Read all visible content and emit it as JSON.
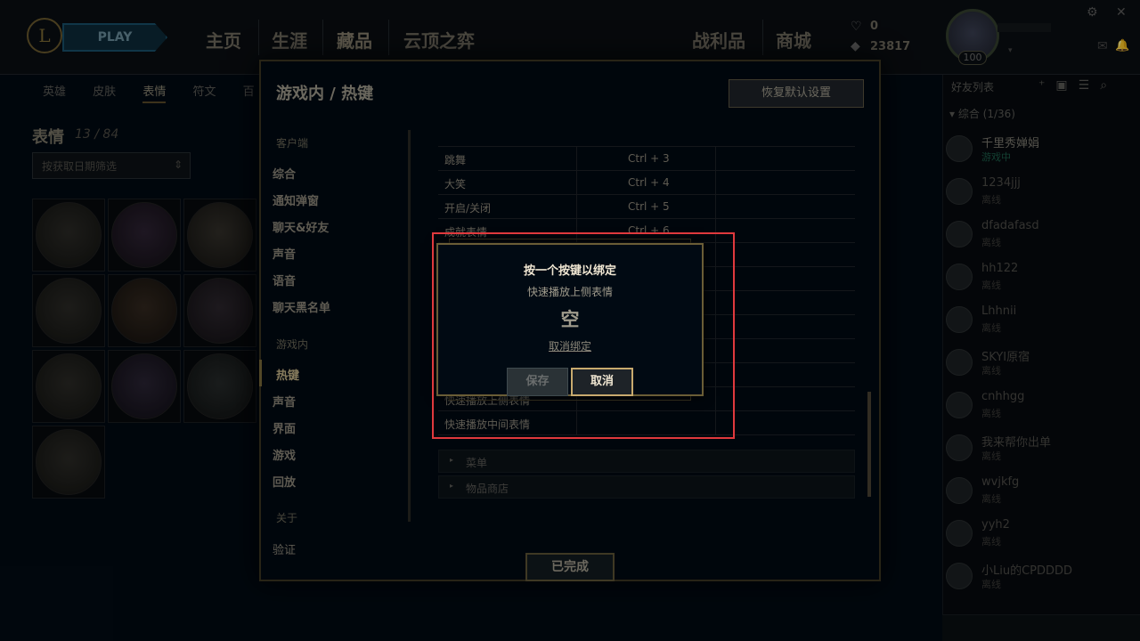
{
  "topnav": {
    "play": "PLAY",
    "items": [
      "主页",
      "生涯",
      "藏品",
      "云顶之弈",
      "战利品",
      "商城"
    ]
  },
  "currency": {
    "be": "0",
    "rp": "23817"
  },
  "profile": {
    "level": "100"
  },
  "collection": {
    "subtabs": [
      "英雄",
      "皮肤",
      "表情",
      "符文",
      "百"
    ],
    "title": "表情",
    "count": "13 / 84",
    "filter": "按获取日期筛选"
  },
  "friends": {
    "title": "好友列表",
    "group": "综合 (1/36)",
    "list": [
      {
        "name": "千里秀婵娟",
        "status": "游戏中"
      },
      {
        "name": "1234jjj",
        "status": "离线"
      },
      {
        "name": "dfadafasd",
        "status": "离线"
      },
      {
        "name": "hh122",
        "status": "离线"
      },
      {
        "name": "Lhhnii",
        "status": "离线"
      },
      {
        "name": "SKYI原宿",
        "status": "离线"
      },
      {
        "name": "cnhhgg",
        "status": "离线"
      },
      {
        "name": "我来帮你出单",
        "status": "离线"
      },
      {
        "name": "wvjkfg",
        "status": "离线"
      },
      {
        "name": "yyh2",
        "status": "离线"
      },
      {
        "name": "小Liu的CPDDDD",
        "status": "离线"
      }
    ]
  },
  "settings": {
    "title": "游戏内 / 热键",
    "restore": "恢复默认设置",
    "categories": {
      "client_head": "客户端",
      "client_items": [
        "综合",
        "通知弹窗",
        "聊天&好友",
        "声音",
        "语音",
        "聊天黑名单"
      ],
      "ingame_head": "游戏内",
      "ingame_items": [
        "热键",
        "声音",
        "界面",
        "游戏",
        "回放"
      ],
      "about_head": "关于",
      "about_items": [
        "验证"
      ]
    },
    "rows": [
      {
        "cmd": "跳舞",
        "key": "Ctrl + 3"
      },
      {
        "cmd": "大笑",
        "key": "Ctrl + 4"
      },
      {
        "cmd": "开启/关闭",
        "key": "Ctrl + 5"
      },
      {
        "cmd": "成就表情",
        "key": "Ctrl + 6"
      },
      {
        "cmd": "快速播放上侧表情",
        "key": ""
      },
      {
        "cmd": "快速播放中间表情",
        "key": ""
      }
    ],
    "sections": [
      "菜单",
      "物品商店"
    ],
    "done": "已完成"
  },
  "bind_dialog": {
    "title": "按一个按键以绑定",
    "subtitle": "快速播放上侧表情",
    "current": "空",
    "unbind": "取消绑定",
    "save": "保存",
    "cancel": "取消"
  },
  "colors": {
    "gold": "#c8aa6e",
    "highlight": "#e0393d",
    "background": "#010a13"
  }
}
